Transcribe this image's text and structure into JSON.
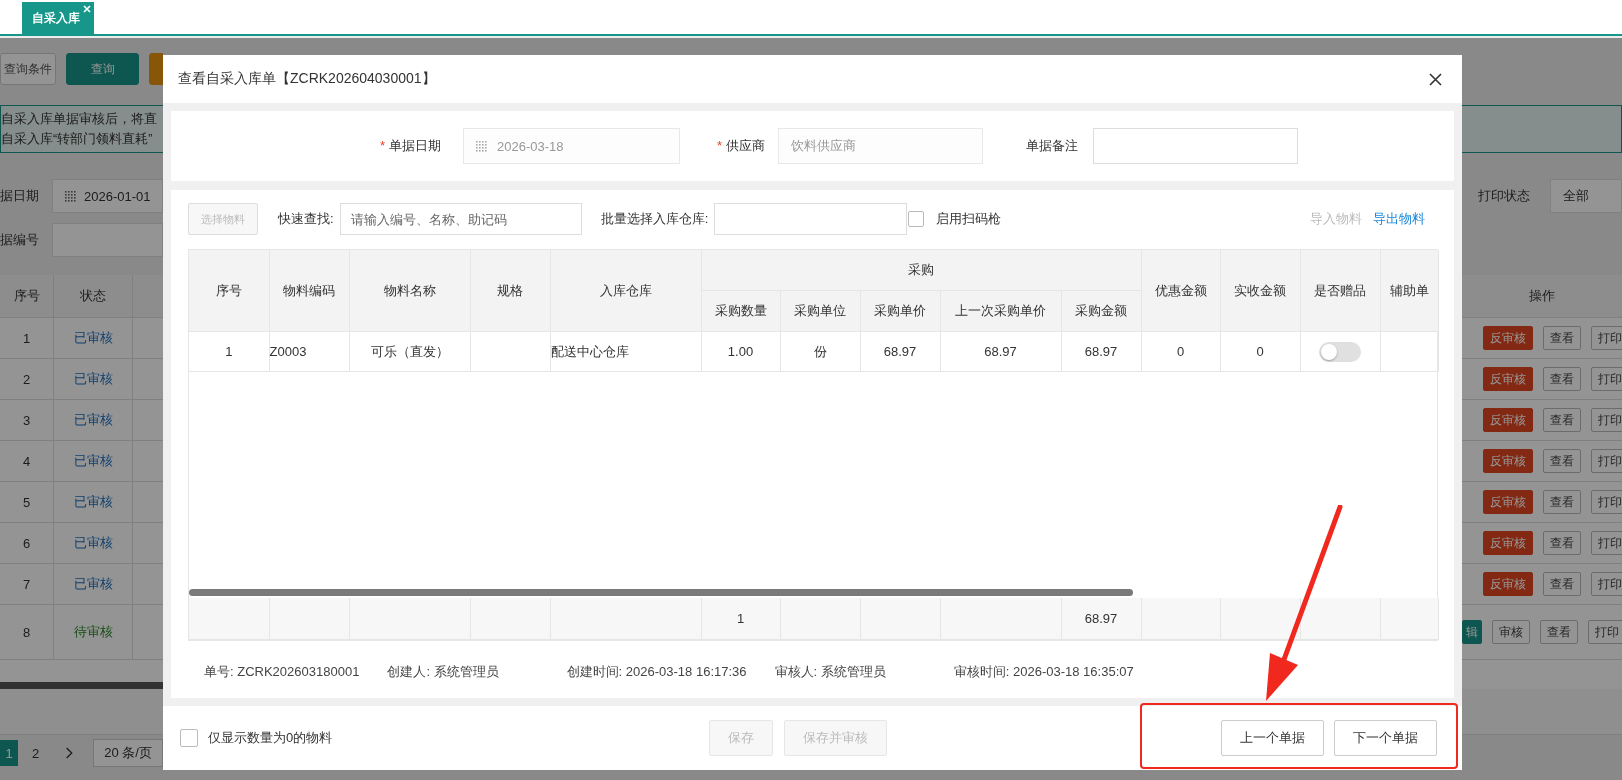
{
  "tab_bar": {
    "tabs": [
      {
        "label": "自采入库",
        "selected": true
      }
    ]
  },
  "background_page": {
    "toolbar": [
      {
        "label": "查询条件",
        "kind": "default"
      },
      {
        "label": "查询",
        "kind": "primary"
      },
      {
        "kind": "warning"
      }
    ],
    "notice_lines": [
      "自采入库单据审核后，将直",
      "自采入库“转部门领料直耗”"
    ],
    "filters": [
      {
        "label": "据日期",
        "value": "2026-01-01",
        "kind": "date"
      },
      {
        "label": "据编号",
        "kind": "text"
      }
    ],
    "print_status": {
      "label": "打印状态",
      "value": "全部"
    },
    "table": {
      "columns": [
        "序号",
        "状态"
      ],
      "action_column": "操作",
      "rows": [
        {
          "index": "1",
          "status": "已审核",
          "kind": "approved",
          "actions": [
            {
              "label": "反审核",
              "kind": "danger"
            },
            {
              "label": "查看",
              "kind": "default"
            },
            {
              "label": "打印",
              "kind": "default"
            }
          ]
        },
        {
          "index": "2",
          "status": "已审核",
          "kind": "approved",
          "actions": [
            {
              "label": "反审核",
              "kind": "danger"
            },
            {
              "label": "查看",
              "kind": "default"
            },
            {
              "label": "打印",
              "kind": "default"
            }
          ]
        },
        {
          "index": "3",
          "status": "已审核",
          "kind": "approved",
          "actions": [
            {
              "label": "反审核",
              "kind": "danger"
            },
            {
              "label": "查看",
              "kind": "default"
            },
            {
              "label": "打印",
              "kind": "default"
            }
          ]
        },
        {
          "index": "4",
          "status": "已审核",
          "kind": "approved",
          "actions": [
            {
              "label": "反审核",
              "kind": "danger"
            },
            {
              "label": "查看",
              "kind": "default"
            },
            {
              "label": "打印",
              "kind": "default"
            }
          ]
        },
        {
          "index": "5",
          "status": "已审核",
          "kind": "approved",
          "actions": [
            {
              "label": "反审核",
              "kind": "danger"
            },
            {
              "label": "查看",
              "kind": "default"
            },
            {
              "label": "打印",
              "kind": "default"
            }
          ]
        },
        {
          "index": "6",
          "status": "已审核",
          "kind": "approved",
          "actions": [
            {
              "label": "反审核",
              "kind": "danger"
            },
            {
              "label": "查看",
              "kind": "default"
            },
            {
              "label": "打印",
              "kind": "default"
            }
          ]
        },
        {
          "index": "7",
          "status": "已审核",
          "kind": "approved",
          "actions": [
            {
              "label": "反审核",
              "kind": "danger"
            },
            {
              "label": "查看",
              "kind": "default"
            },
            {
              "label": "打印",
              "kind": "default"
            }
          ]
        },
        {
          "index": "8",
          "status": "待审核",
          "kind": "pending",
          "actions": [
            {
              "label": "辑",
              "kind": "primary"
            },
            {
              "label": "审核",
              "kind": "default"
            },
            {
              "label": "查看",
              "kind": "default"
            },
            {
              "label": "打印",
              "kind": "default"
            }
          ]
        }
      ]
    },
    "pagination": {
      "pages": [
        {
          "label": "1",
          "selected": true
        },
        {
          "label": "2",
          "selected": false
        }
      ],
      "page_size": "20 条/页"
    }
  },
  "dialog": {
    "title": "查看自采入库单【ZCRK202604030001】",
    "form": [
      {
        "label": "单据日期",
        "required_mark": "*",
        "value": "2026-03-18",
        "kind": "date",
        "disabled": true
      },
      {
        "label": "供应商",
        "required_mark": "*",
        "value": "饮料供应商",
        "kind": "text",
        "disabled": true
      },
      {
        "label": "单据备注",
        "kind": "text"
      }
    ],
    "toolbar": {
      "select_button": {
        "label": "选择物料",
        "disabled": true
      },
      "quick_search": {
        "label": "快速查找:",
        "placeholder": "请输入编号、名称、助记码"
      },
      "batch_warehouse": {
        "label": "批量选择入库仓库:"
      },
      "scanner": {
        "label": "启用扫码枪",
        "checked": false
      },
      "links": [
        {
          "label": "导入物料",
          "disabled": true
        },
        {
          "label": "导出物料",
          "disabled": false
        }
      ]
    },
    "table": {
      "columns": [
        {
          "label": "序号"
        },
        {
          "label": "物料编码"
        },
        {
          "label": "物料名称"
        },
        {
          "label": "规格"
        },
        {
          "label": "入库仓库"
        },
        {
          "label": "采购",
          "children": [
            "采购数量",
            "采购单位",
            "采购单价",
            "上一次采购单价",
            "采购金额"
          ]
        },
        {
          "label": "优惠金额"
        },
        {
          "label": "实收金额"
        },
        {
          "label": "是否赠品"
        },
        {
          "label": "辅助单"
        }
      ],
      "rows": [
        {
          "index": "1",
          "code": "Z0003",
          "name": "可乐（直发）",
          "warehouse": "配送中心仓库",
          "qty": "1.00",
          "unit": "份",
          "price": "68.97",
          "last_price": "68.97",
          "amount": "68.97",
          "discount": "0",
          "received": "0",
          "gift": false
        }
      ],
      "totals": {
        "qty": "1",
        "amount": "68.97"
      }
    },
    "info": [
      "单号: ZCRK202603180001",
      "创建人: 系统管理员",
      "创建时间: 2026-03-18 16:17:36",
      "审核人: 系统管理员",
      "审核时间: 2026-03-18 16:35:07"
    ],
    "footer": {
      "zero_only": {
        "label": "仅显示数量为0的物料",
        "checked": false
      },
      "actions": [
        {
          "label": "保存",
          "disabled": true
        },
        {
          "label": "保存并审核",
          "disabled": true
        },
        {
          "label": "上一个单据",
          "disabled": false
        },
        {
          "label": "下一个单据",
          "disabled": false
        }
      ]
    }
  }
}
